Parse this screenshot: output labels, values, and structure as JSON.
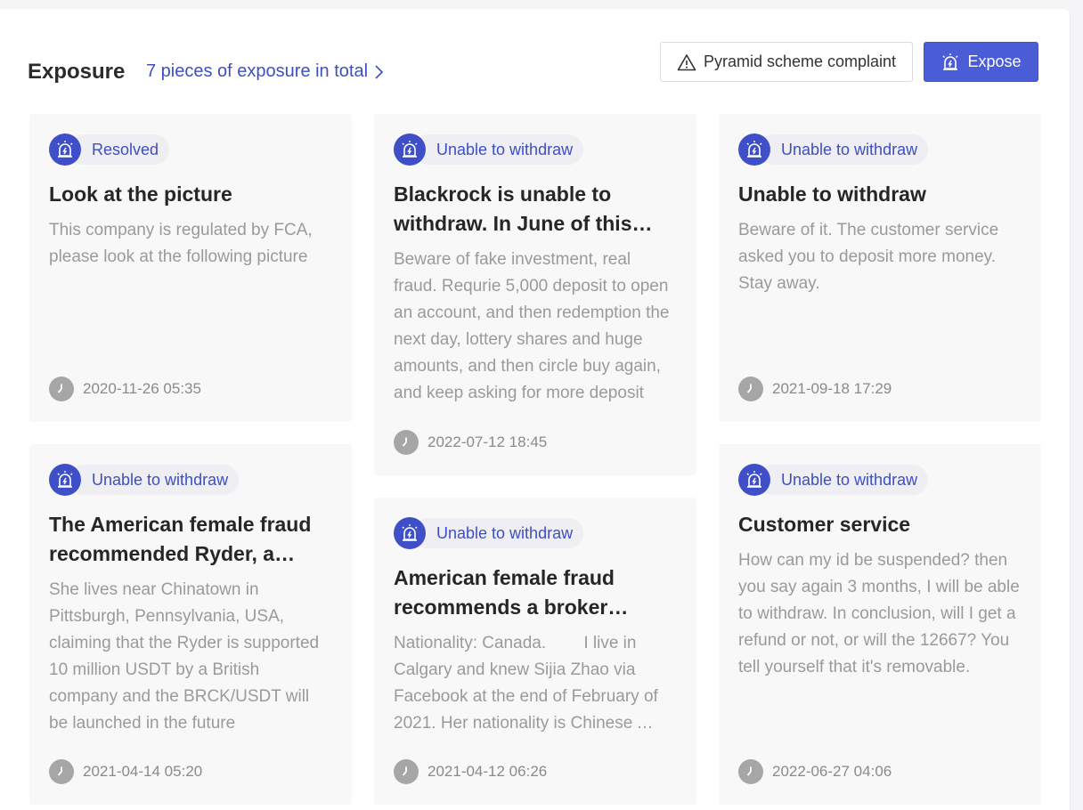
{
  "header": {
    "title": "Exposure",
    "total_link": "7 pieces of exposure in total",
    "complaint_button": "Pyramid scheme complaint",
    "expose_button": "Expose"
  },
  "colors": {
    "accent": "#4a5cd6",
    "tag_text": "#3d4fc4",
    "card_bg": "#f8f8f9"
  },
  "cards": [
    {
      "tag": "Resolved",
      "title": "Look at the picture",
      "body": "This company is regulated by FCA, please look at the following picture",
      "time": "2020-11-26 05:35"
    },
    {
      "tag": "Unable to withdraw",
      "title": "Blackrock is unable to withdraw. In June of this year, BlackRock",
      "body": "Beware of fake investment, real fraud. Requrie 5,000 deposit to open an account, and then redemption the next day, lottery shares and huge amounts, and then circle buy again, and keep asking for more deposit",
      "time": "2022-07-12 18:45"
    },
    {
      "tag": "Unable to withdraw",
      "title": "Unable to withdraw",
      "body": "Beware of it. The customer service asked you to deposit more money. Stay away.",
      "time": "2021-09-18 17:29"
    },
    {
      "tag": "Unable to withdraw",
      "title": "The American female fraud recommended Ryder, a broker",
      "body": "She lives near Chinatown in Pittsburgh, Pennsylvania, USA, claiming that the Ryder is supported 10 million USDT by a British company and the BRCK/USDT will be launched in the future",
      "time": "2021-04-14 05:20"
    },
    {
      "tag": "Unable to withdraw",
      "title": "American female fraud recommends a broker named Ryder",
      "body": "Nationality: Canada.        I live in Calgary and knew Sijia Zhao via Facebook at the end of February of 2021. Her nationality is Chinese American",
      "time": "2021-04-12 06:26"
    },
    {
      "tag": "Unable to withdraw",
      "title": "Customer service",
      "body": "How can my id be suspended? then you say again 3 months, I will be able to withdraw. In conclusion, will I get a refund or not, or will the 12667? You tell yourself that it's removable.",
      "time": "2022-06-27 04:06"
    }
  ]
}
